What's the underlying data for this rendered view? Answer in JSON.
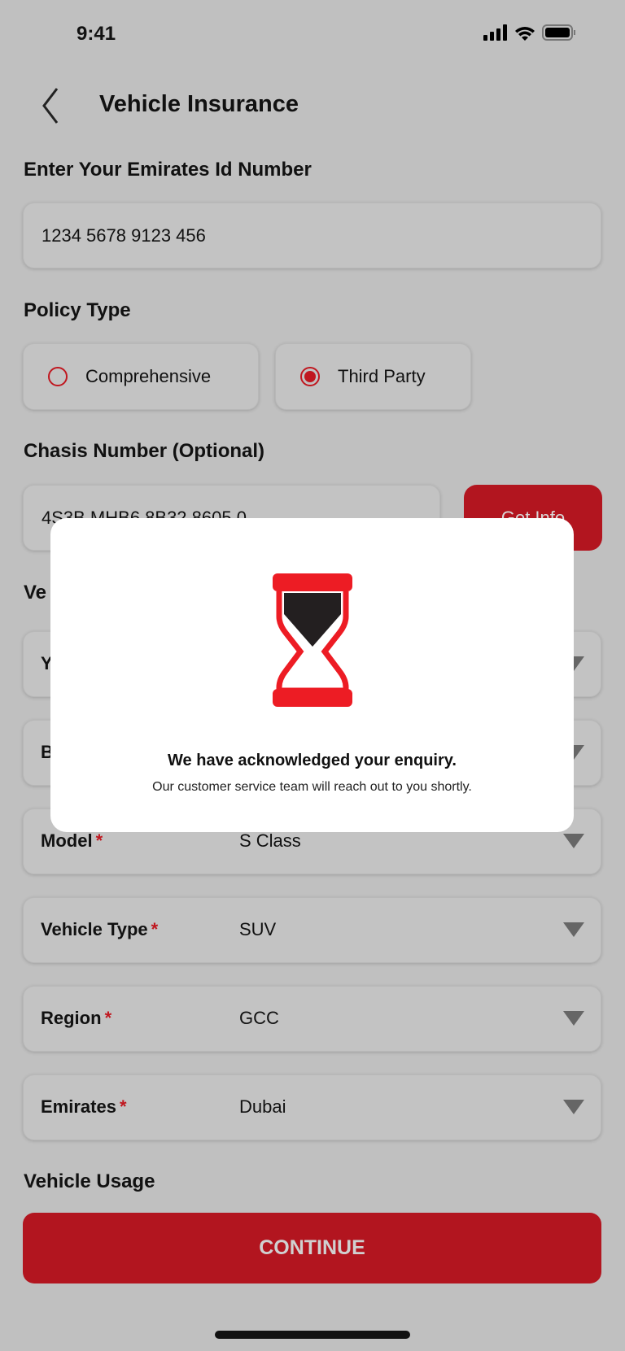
{
  "status_bar": {
    "time": "9:41"
  },
  "header": {
    "title": "Vehicle Insurance"
  },
  "emirates_id": {
    "label": "Enter Your Emirates Id Number",
    "value": "1234 5678 9123 456"
  },
  "policy_type": {
    "label": "Policy Type",
    "options": [
      {
        "label": "Comprehensive",
        "selected": false
      },
      {
        "label": "Third Party",
        "selected": true
      }
    ]
  },
  "chassis": {
    "label": "Chasis Number (Optional)",
    "value": "4S3B MHB6 8B32 8605 0",
    "button": "Get Info"
  },
  "vehicle_section": {
    "label": "Ve"
  },
  "dropdowns": [
    {
      "label": "Y",
      "value": ""
    },
    {
      "label": "B",
      "value": ""
    },
    {
      "label": "Model",
      "value": "S Class",
      "required": "*"
    },
    {
      "label": "Vehicle Type",
      "value": "SUV",
      "required": "*"
    },
    {
      "label": "Region",
      "value": "GCC",
      "required": "*"
    },
    {
      "label": "Emirates",
      "value": "Dubai",
      "required": "*"
    }
  ],
  "usage": {
    "label": "Vehicle Usage"
  },
  "continue_label": "CONTINUE",
  "modal": {
    "icon": "hourglass-icon",
    "heading": "We have acknowledged your enquiry.",
    "message": "Our customer service team will reach out to you shortly."
  },
  "colors": {
    "accent": "#b2151f",
    "icon_red": "#ed1c24"
  }
}
